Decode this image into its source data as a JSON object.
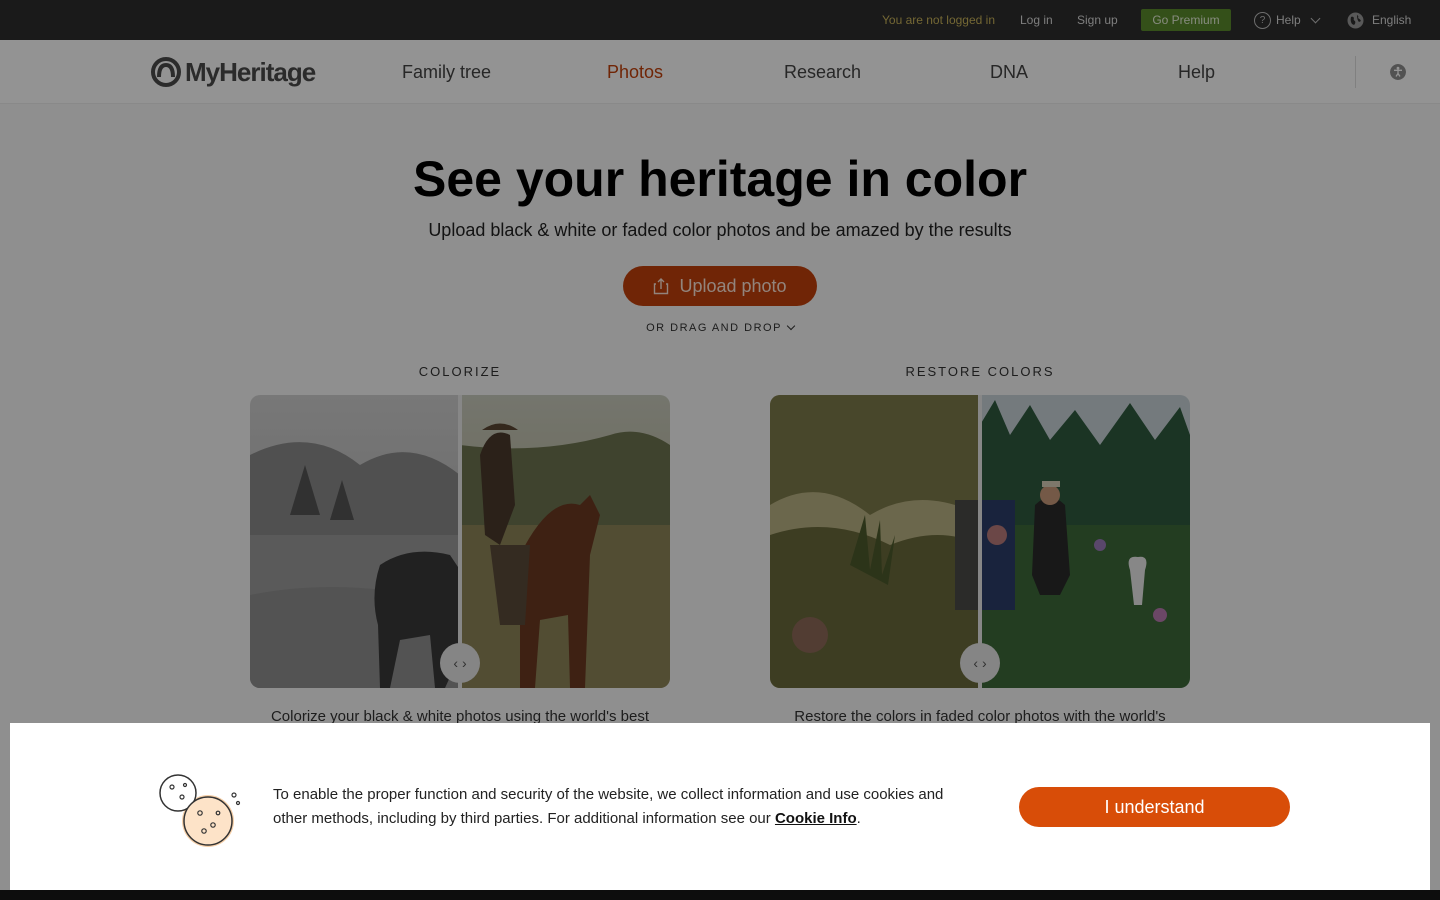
{
  "topbar": {
    "not_logged_in": "You are not logged in",
    "login": "Log in",
    "signup": "Sign up",
    "premium": "Go Premium",
    "help": "Help",
    "language": "English"
  },
  "nav": {
    "brand": "MyHeritage",
    "items": [
      "Family tree",
      "Photos",
      "Research",
      "DNA",
      "Help"
    ],
    "active": "Photos"
  },
  "hero": {
    "title": "See your heritage in color",
    "subtitle": "Upload black & white or faded color photos and be amazed by the results",
    "upload_label": "Upload photo",
    "drag_label": "OR DRAG AND DROP"
  },
  "sections": [
    {
      "label": "COLORIZE",
      "description": "Colorize your black & white photos using the world's best"
    },
    {
      "label": "RESTORE COLORS",
      "description": "Restore the colors in faded color photos with the world's"
    }
  ],
  "cookie": {
    "text": "To enable the proper function and security of the website, we collect information and use cookies and other methods, including by third parties. For additional information see our",
    "link": "Cookie Info",
    "button": "I understand"
  },
  "colors": {
    "accent": "#c2410c",
    "cookie_button": "#d84d08",
    "premium": "#5b8a2c",
    "topbar": "#2d2d2d"
  }
}
